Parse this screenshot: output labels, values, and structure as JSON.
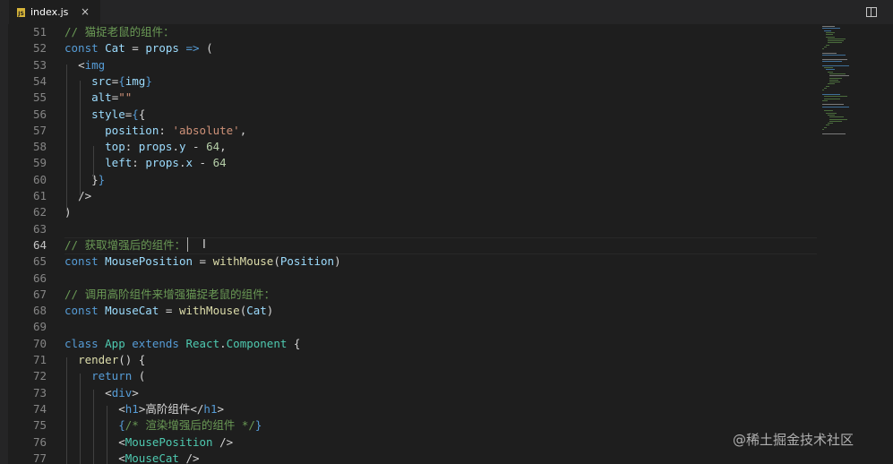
{
  "tab": {
    "file_name": "index.js",
    "icon": "js-file-icon",
    "close_glyph": "×"
  },
  "toolbar": {
    "split_icon": "split-editor-icon",
    "more_glyph": "···"
  },
  "lines": [
    {
      "n": "51",
      "tokens": [
        [
          "c",
          "// 猫捉老鼠的组件："
        ]
      ]
    },
    {
      "n": "52",
      "tokens": [
        [
          "k",
          "const "
        ],
        [
          "v",
          "Cat"
        ],
        [
          "p",
          " = "
        ],
        [
          "v",
          "props"
        ],
        [
          "k",
          " => "
        ],
        [
          "p",
          "("
        ]
      ]
    },
    {
      "n": "53",
      "tokens": [
        [
          "p",
          "  "
        ],
        [
          "br",
          "<"
        ],
        [
          "k",
          "img"
        ]
      ]
    },
    {
      "n": "54",
      "tokens": [
        [
          "p",
          "    "
        ],
        [
          "v",
          "src"
        ],
        [
          "p",
          "="
        ],
        [
          "k",
          "{"
        ],
        [
          "v",
          "img"
        ],
        [
          "k",
          "}"
        ]
      ]
    },
    {
      "n": "55",
      "tokens": [
        [
          "p",
          "    "
        ],
        [
          "v",
          "alt"
        ],
        [
          "p",
          "="
        ],
        [
          "s",
          "\"\""
        ]
      ]
    },
    {
      "n": "56",
      "tokens": [
        [
          "p",
          "    "
        ],
        [
          "v",
          "style"
        ],
        [
          "p",
          "="
        ],
        [
          "k",
          "{"
        ],
        [
          "p",
          "{"
        ]
      ]
    },
    {
      "n": "57",
      "tokens": [
        [
          "p",
          "      "
        ],
        [
          "v",
          "position"
        ],
        [
          "p",
          ": "
        ],
        [
          "s",
          "'absolute'"
        ],
        [
          "p",
          ","
        ]
      ]
    },
    {
      "n": "58",
      "tokens": [
        [
          "p",
          "      "
        ],
        [
          "v",
          "top"
        ],
        [
          "p",
          ": "
        ],
        [
          "v",
          "props"
        ],
        [
          "p",
          "."
        ],
        [
          "v",
          "y"
        ],
        [
          "p",
          " - "
        ],
        [
          "n",
          "64"
        ],
        [
          "p",
          ","
        ]
      ]
    },
    {
      "n": "59",
      "tokens": [
        [
          "p",
          "      "
        ],
        [
          "v",
          "left"
        ],
        [
          "p",
          ": "
        ],
        [
          "v",
          "props"
        ],
        [
          "p",
          "."
        ],
        [
          "v",
          "x"
        ],
        [
          "p",
          " - "
        ],
        [
          "n",
          "64"
        ]
      ]
    },
    {
      "n": "60",
      "tokens": [
        [
          "p",
          "    "
        ],
        [
          "p",
          "}"
        ],
        [
          "k",
          "}"
        ]
      ]
    },
    {
      "n": "61",
      "tokens": [
        [
          "p",
          "  "
        ],
        [
          "br",
          "/>"
        ]
      ]
    },
    {
      "n": "62",
      "tokens": [
        [
          "p",
          ")"
        ]
      ]
    },
    {
      "n": "63",
      "tokens": []
    },
    {
      "n": "64",
      "current": true,
      "tokens": [
        [
          "c",
          "// 获取增强后的组件："
        ]
      ]
    },
    {
      "n": "65",
      "tokens": [
        [
          "k",
          "const "
        ],
        [
          "v",
          "MousePosition"
        ],
        [
          "p",
          " = "
        ],
        [
          "f",
          "withMouse"
        ],
        [
          "p",
          "("
        ],
        [
          "v",
          "Position"
        ],
        [
          "p",
          ")"
        ]
      ]
    },
    {
      "n": "66",
      "tokens": []
    },
    {
      "n": "67",
      "tokens": [
        [
          "c",
          "// 调用高阶组件来增强猫捉老鼠的组件："
        ]
      ]
    },
    {
      "n": "68",
      "tokens": [
        [
          "k",
          "const "
        ],
        [
          "v",
          "MouseCat"
        ],
        [
          "p",
          " = "
        ],
        [
          "f",
          "withMouse"
        ],
        [
          "p",
          "("
        ],
        [
          "v",
          "Cat"
        ],
        [
          "p",
          ")"
        ]
      ]
    },
    {
      "n": "69",
      "tokens": []
    },
    {
      "n": "70",
      "tokens": [
        [
          "k",
          "class "
        ],
        [
          "t",
          "App "
        ],
        [
          "k",
          "extends "
        ],
        [
          "t",
          "React"
        ],
        [
          "p",
          "."
        ],
        [
          "t",
          "Component"
        ],
        [
          "p",
          " {"
        ]
      ]
    },
    {
      "n": "71",
      "tokens": [
        [
          "p",
          "  "
        ],
        [
          "f",
          "render"
        ],
        [
          "p",
          "() {"
        ]
      ]
    },
    {
      "n": "72",
      "tokens": [
        [
          "p",
          "    "
        ],
        [
          "k",
          "return"
        ],
        [
          "p",
          " ("
        ]
      ]
    },
    {
      "n": "73",
      "tokens": [
        [
          "p",
          "      "
        ],
        [
          "br",
          "<"
        ],
        [
          "k",
          "div"
        ],
        [
          "br",
          ">"
        ]
      ]
    },
    {
      "n": "74",
      "tokens": [
        [
          "p",
          "        "
        ],
        [
          "br",
          "<"
        ],
        [
          "k",
          "h1"
        ],
        [
          "br",
          ">"
        ],
        [
          "p",
          "高阶组件"
        ],
        [
          "br",
          "</"
        ],
        [
          "k",
          "h1"
        ],
        [
          "br",
          ">"
        ]
      ]
    },
    {
      "n": "75",
      "tokens": [
        [
          "p",
          "        "
        ],
        [
          "k",
          "{"
        ],
        [
          "c",
          "/* 渲染增强后的组件 */"
        ],
        [
          "k",
          "}"
        ]
      ]
    },
    {
      "n": "76",
      "tokens": [
        [
          "p",
          "        "
        ],
        [
          "br",
          "<"
        ],
        [
          "t",
          "MousePosition"
        ],
        [
          "br",
          " />"
        ]
      ]
    },
    {
      "n": "77",
      "tokens": [
        [
          "p",
          "        "
        ],
        [
          "br",
          "<"
        ],
        [
          "t",
          "MouseCat"
        ],
        [
          "br",
          " />"
        ]
      ]
    }
  ],
  "watermark": "@稀土掘金技术社区"
}
